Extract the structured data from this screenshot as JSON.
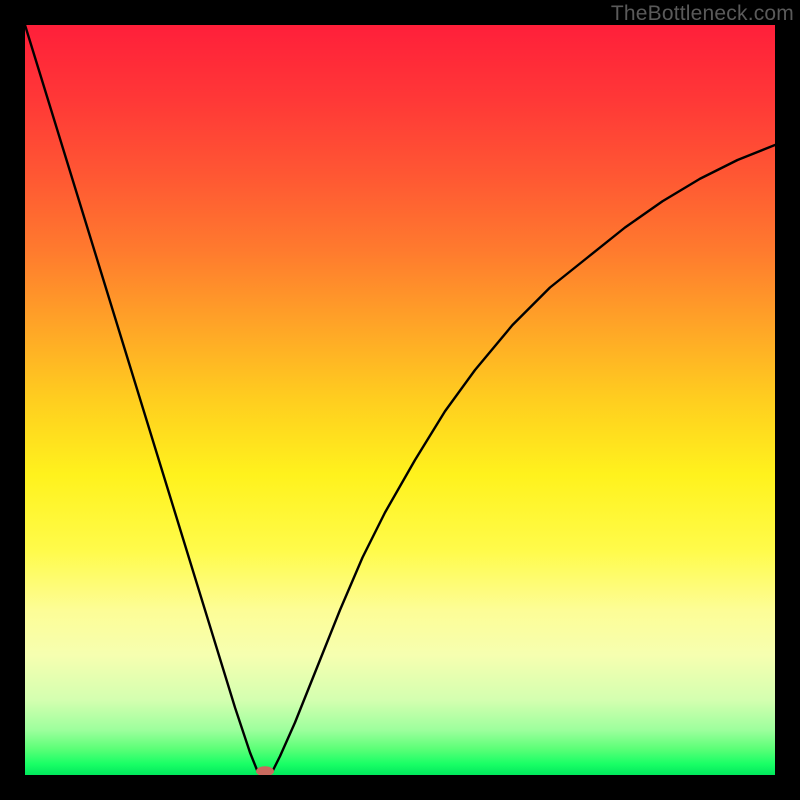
{
  "watermark": "TheBottleneck.com",
  "chart_data": {
    "type": "line",
    "title": "",
    "xlabel": "",
    "ylabel": "",
    "xlim": [
      0,
      100
    ],
    "ylim": [
      0,
      100
    ],
    "x": [
      0,
      2,
      4,
      6,
      8,
      10,
      12,
      14,
      16,
      18,
      20,
      22,
      24,
      26,
      28,
      30,
      31,
      32,
      33,
      34,
      36,
      38,
      40,
      42,
      45,
      48,
      52,
      56,
      60,
      65,
      70,
      75,
      80,
      85,
      90,
      95,
      100
    ],
    "values": [
      100,
      93.5,
      87,
      80.5,
      74,
      67.5,
      61,
      54.5,
      48,
      41.5,
      35,
      28.5,
      22,
      15.5,
      9,
      3,
      0.5,
      0,
      0.5,
      2.5,
      7,
      12,
      17,
      22,
      29,
      35,
      42,
      48.5,
      54,
      60,
      65,
      69,
      73,
      76.5,
      79.5,
      82,
      84
    ],
    "gradient_stops": [
      {
        "offset": 0.0,
        "color": "#ff1f3a"
      },
      {
        "offset": 0.1,
        "color": "#ff3837"
      },
      {
        "offset": 0.2,
        "color": "#ff5733"
      },
      {
        "offset": 0.3,
        "color": "#ff7a2e"
      },
      {
        "offset": 0.4,
        "color": "#ffa427"
      },
      {
        "offset": 0.5,
        "color": "#ffce1f"
      },
      {
        "offset": 0.6,
        "color": "#fff21d"
      },
      {
        "offset": 0.7,
        "color": "#fffb4a"
      },
      {
        "offset": 0.78,
        "color": "#fdfd96"
      },
      {
        "offset": 0.84,
        "color": "#f6ffb0"
      },
      {
        "offset": 0.9,
        "color": "#d4ffb0"
      },
      {
        "offset": 0.94,
        "color": "#9dff9d"
      },
      {
        "offset": 0.965,
        "color": "#5cff78"
      },
      {
        "offset": 0.985,
        "color": "#1aff66"
      },
      {
        "offset": 1.0,
        "color": "#00e85c"
      }
    ],
    "marker": {
      "x": 32,
      "y": 0.5,
      "rx": 9,
      "ry": 5,
      "color": "#c96a5e"
    },
    "curve_color": "#000000",
    "curve_width": 2.4
  }
}
